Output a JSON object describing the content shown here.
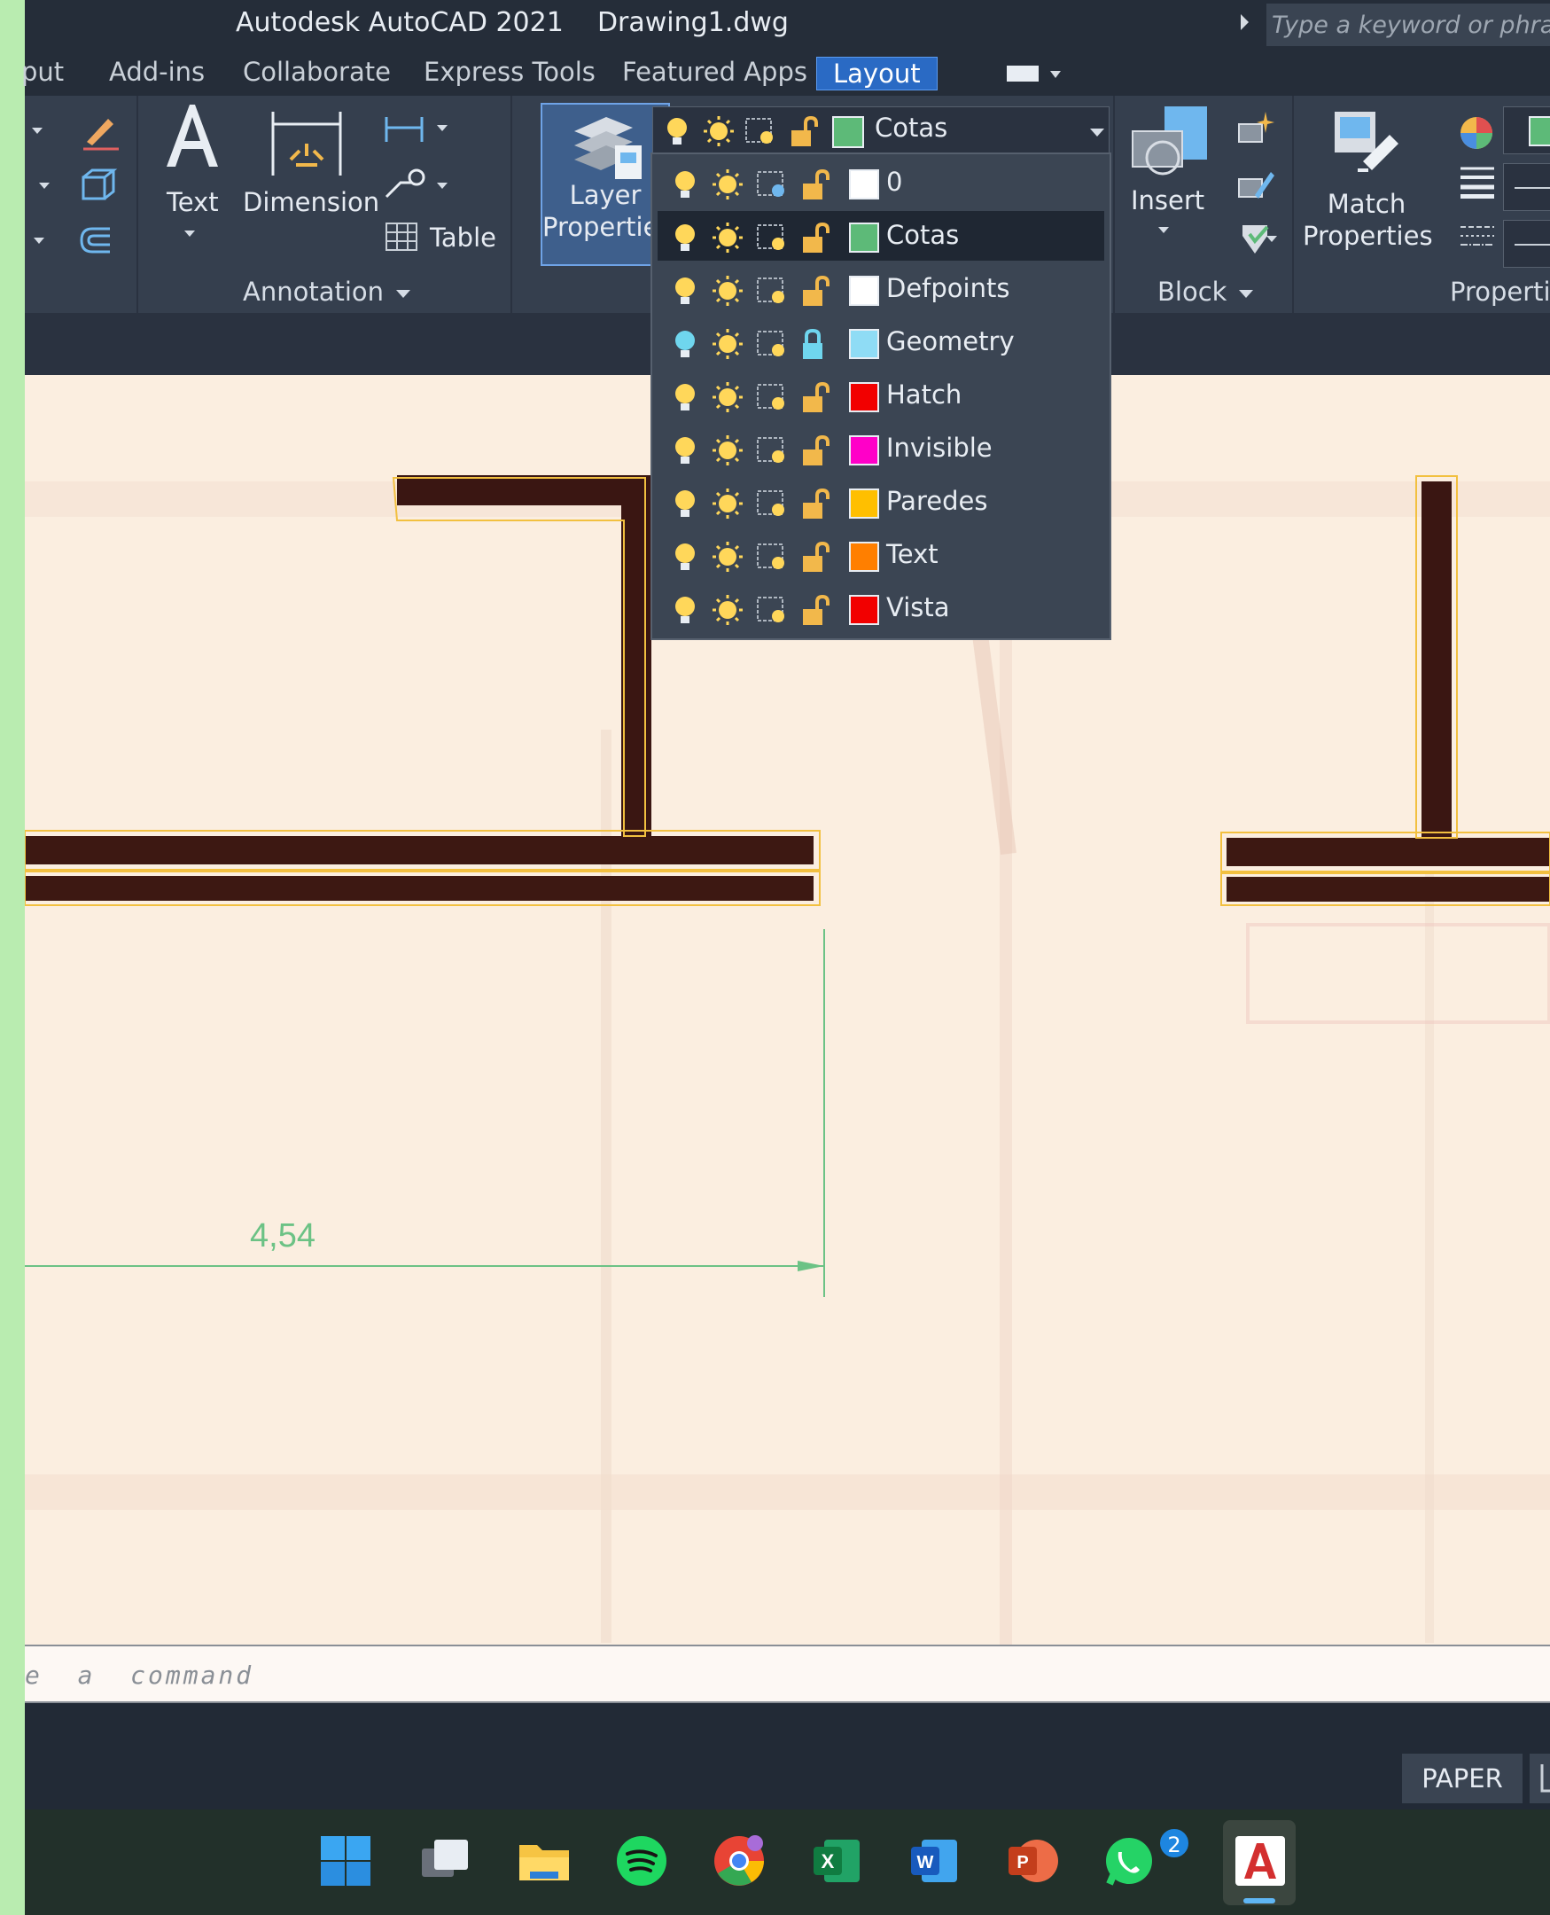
{
  "window": {
    "title": "Autodesk AutoCAD 2021    Drawing1.dwg"
  },
  "search": {
    "placeholder": "Type a keyword or phrase"
  },
  "tabs": [
    {
      "label": "put"
    },
    {
      "label": "Add-ins"
    },
    {
      "label": "Collaborate"
    },
    {
      "label": "Express Tools"
    },
    {
      "label": "Featured Apps"
    },
    {
      "label": "Layout",
      "active": true
    }
  ],
  "ribbon": {
    "text_label": "Text",
    "dimension_label": "Dimension",
    "table_label": "Table",
    "layer_properties_line1": "Layer",
    "layer_properties_line2": "Properties",
    "annotation_panel": "Annotation",
    "insert_label": "Insert",
    "block_panel": "Block",
    "match_line1": "Match",
    "match_line2": "Properties",
    "properties_panel": "Propertie"
  },
  "layer_dropdown": {
    "current": {
      "name": "Cotas",
      "color": "#5dba78"
    },
    "layers": [
      {
        "name": "0",
        "color": "#ffffff",
        "locked": false,
        "bulb": "#ffd75a"
      },
      {
        "name": "Cotas",
        "color": "#5dba78",
        "locked": false,
        "bulb": "#ffd75a",
        "selected": true
      },
      {
        "name": "Defpoints",
        "color": "#ffffff",
        "locked": false,
        "bulb": "#ffd75a"
      },
      {
        "name": "Geometry",
        "color": "#8fdcf5",
        "locked": true,
        "bulb": "#6fd6ee"
      },
      {
        "name": "Hatch",
        "color": "#f20000",
        "locked": false,
        "bulb": "#ffd75a"
      },
      {
        "name": "Invisible",
        "color": "#ff00c8",
        "locked": false,
        "bulb": "#ffd75a"
      },
      {
        "name": "Paredes",
        "color": "#ffbf00",
        "locked": false,
        "bulb": "#ffd75a"
      },
      {
        "name": "Text",
        "color": "#ff7f00",
        "locked": false,
        "bulb": "#ffd75a"
      },
      {
        "name": "Vista",
        "color": "#f20000",
        "locked": false,
        "bulb": "#ffd75a"
      }
    ]
  },
  "drawing": {
    "dimension_text": "4,54"
  },
  "command": {
    "placeholder": "e  a  command"
  },
  "status": {
    "paper": "PAPER"
  },
  "taskbar": {
    "apps": [
      "start-icon",
      "task-view-icon",
      "file-explorer-icon",
      "spotify-icon",
      "chrome-icon",
      "excel-icon",
      "word-icon",
      "powerpoint-icon",
      "whatsapp-icon",
      "autocad-icon"
    ],
    "whatsapp_badge": "2"
  }
}
